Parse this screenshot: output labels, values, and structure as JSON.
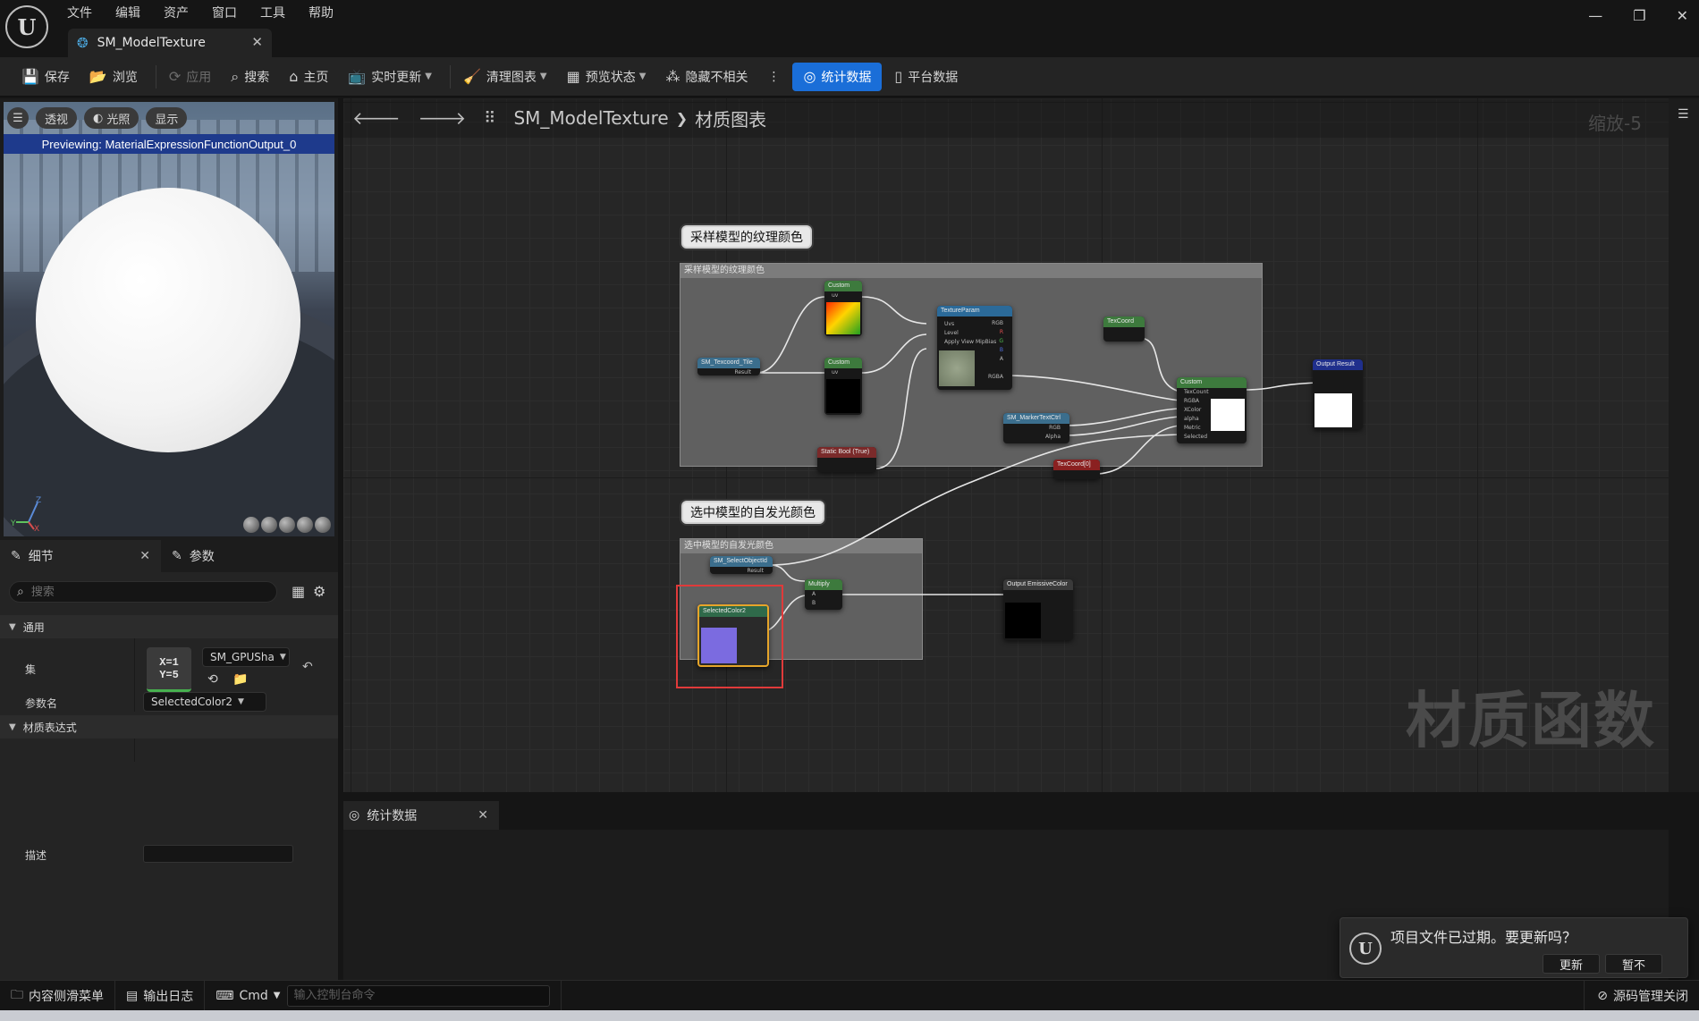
{
  "menu": [
    "文件",
    "编辑",
    "资产",
    "窗口",
    "工具",
    "帮助"
  ],
  "document_tab": {
    "title": "SM_ModelTexture"
  },
  "toolbar": {
    "save": "保存",
    "browse": "浏览",
    "apply": "应用",
    "search": "搜索",
    "home": "主页",
    "live_update": "实时更新",
    "clean_graph": "清理图表",
    "preview_state": "预览状态",
    "hide_unrelated": "隐藏不相关",
    "stats": "统计数据",
    "platform_stats": "平台数据"
  },
  "viewport": {
    "buttons": [
      "透视",
      "光照",
      "显示"
    ],
    "preview_text": "Previewing: MaterialExpressionFunctionOutput_0",
    "axes": [
      "Z",
      "Y",
      "X"
    ]
  },
  "details": {
    "tab_details": "细节",
    "tab_params": "参数",
    "search_placeholder": "搜索",
    "cat_general": "通用",
    "label_collection": "集",
    "collection_value": "SM_GPUSha",
    "thumb_line1": "X=1",
    "thumb_line2": "Y=5",
    "label_param_name": "参数名",
    "param_name_value": "SelectedColor2",
    "cat_expression": "材质表达式",
    "label_desc": "描述"
  },
  "graph": {
    "breadcrumb_asset": "SM_ModelTexture",
    "breadcrumb_graph": "材质图表",
    "zoom": "缩放-5",
    "watermark": "材质函数",
    "comment1_bubble": "采样模型的纹理颜色",
    "comment1_title": "采样模型的纹理颜色",
    "comment2_bubble": "选中模型的自发光颜色",
    "comment2_title": "选中模型的自发光颜色",
    "nodes": {
      "texcoord_tile": "SM_Texcoord_Tile",
      "texcoord_tile_pin": "Result",
      "custom1": "Custom",
      "custom1_pin": "uv",
      "custom2": "Custom",
      "custom2_pin": "uv",
      "static_bool": "Static Bool (True)",
      "texture_param": "TextureParam",
      "tp_pin_uvs": "Uvs",
      "tp_pin_level": "Level",
      "tp_pin_apply": "Apply View MipBias",
      "tp_out_rgb": "RGB",
      "tp_out_r": "R",
      "tp_out_g": "G",
      "tp_out_b": "B",
      "tp_out_a": "A",
      "tp_out_rgba": "RGBA",
      "texcoord_small": "TexCoord",
      "marker_ctrl": "SM_MarkerTextCtrl",
      "marker_rgb": "RGB",
      "marker_alpha": "Alpha",
      "texcoord_red": "TexCoord[0]",
      "custom_big": "Custom",
      "cb_pins": [
        "TexCount",
        "RGBA",
        "XColor",
        "alpha",
        "Metric",
        "Selected"
      ],
      "output_result": "Output Result",
      "select_node": "SM_SelectObjectId",
      "select_node_pin": "Result",
      "selected_color": "SelectedColor2",
      "multiply": "Multiply",
      "multiply_pins": [
        "A",
        "B"
      ],
      "output_emissive": "Output EmissiveColor"
    },
    "colors": {
      "selected_swatch": "#7b6be0",
      "selection_box": "#e03a3a"
    }
  },
  "stats_panel": {
    "tab": "统计数据"
  },
  "toast": {
    "message": "项目文件已过期。要更新吗？",
    "update": "更新",
    "not_now": "暂不"
  },
  "statusbar": {
    "content_drawer": "内容侧滑菜单",
    "output_log": "输出日志",
    "cmd": "Cmd",
    "cmd_placeholder": "输入控制台命令",
    "source_control": "源码管理关闭"
  }
}
